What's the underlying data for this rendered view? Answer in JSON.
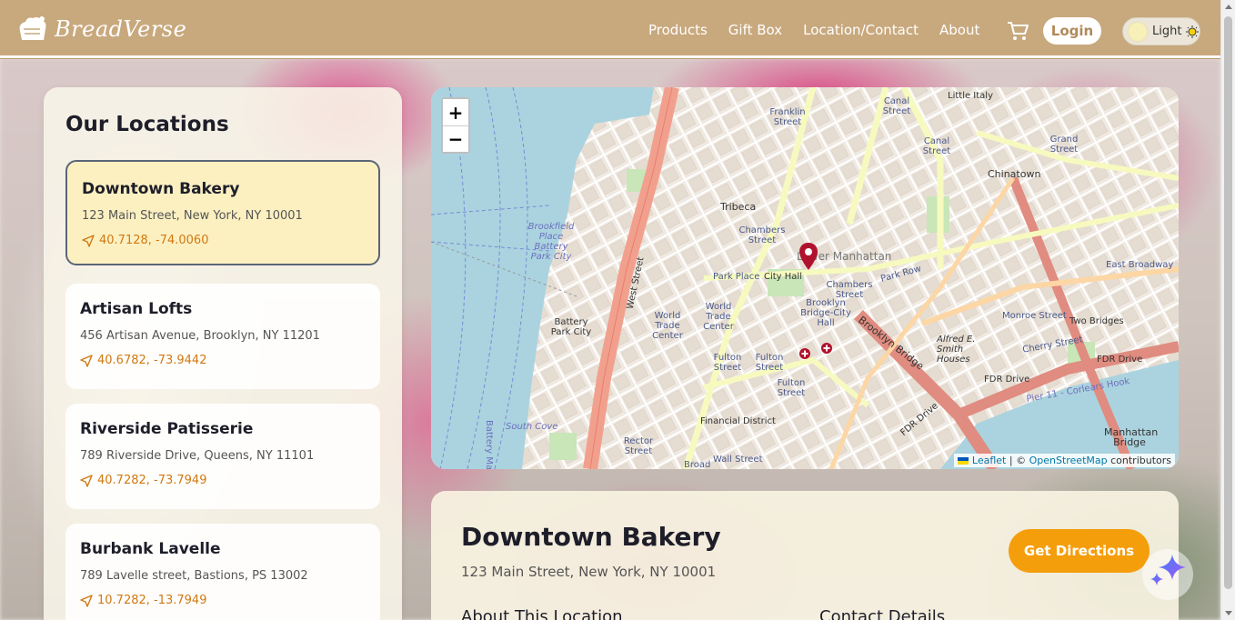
{
  "brand": {
    "name": "BreadVerse"
  },
  "nav": [
    "Products",
    "Gift Box",
    "Location/Contact",
    "About"
  ],
  "header": {
    "login_label": "Login",
    "theme_label": "Light"
  },
  "sidebar": {
    "title": "Our Locations",
    "locations": [
      {
        "name": "Downtown Bakery",
        "address": "123 Main Street, New York, NY 10001",
        "coords": "40.7128, -74.0060",
        "active": true
      },
      {
        "name": "Artisan Lofts",
        "address": "456 Artisan Avenue, Brooklyn, NY 11201",
        "coords": "40.6782, -73.9442"
      },
      {
        "name": "Riverside Patisserie",
        "address": "789 Riverside Drive, Queens, NY 11101",
        "coords": "40.7282, -73.7949"
      },
      {
        "name": "Burbank Lavelle",
        "address": "789 Lavelle street, Bastions, PS 13002",
        "coords": "10.7282, -13.7949"
      }
    ]
  },
  "map": {
    "zoom_in": "+",
    "zoom_out": "−",
    "attribution_leaflet": "Leaflet",
    "attribution_sep": " | © ",
    "attribution_osm": "OpenStreetMap",
    "attribution_tail": " contributors",
    "labels": {
      "franklin": "Franklin Street",
      "canal": "Canal Street",
      "canal2": "Canal Street",
      "little_italy": "Little Italy",
      "grand": "Grand Street",
      "chinatown": "Chinatown",
      "tribeca": "Tribeca",
      "chambers": "Chambers Street",
      "chambers2": "Chambers Street",
      "lower_manhattan": "Lower Manhattan",
      "park_place": "Park Place",
      "city_hall": "City Hall",
      "brooklyn_bridge_ch": "Brooklyn Bridge-City Hall",
      "brooklyn_bridge": "Brooklyn Bridge",
      "wtc": "World Trade Center",
      "wtc2": "World Trade Center",
      "battery_park_city": "Battery Park City",
      "brookfield": "Brookfield Place Battery Park City",
      "fulton": "Fulton Street",
      "fulton2": "Fulton Street",
      "fulton3": "Fulton Street",
      "financial": "Financial District",
      "rector": "Rector Street",
      "wall": "Wall Street",
      "broad": "Broad",
      "south_cove": "South Cove",
      "west_street": "West Street",
      "east_broadway": "East Broadway",
      "two_bridges": "Two Bridges",
      "alfred": "Alfred E. Smith Houses",
      "fdr": "FDR Drive",
      "fdr2": "FDR Drive",
      "fdr3": "FDR Drive",
      "pier": "Pier 11 - Corlears Hook",
      "manhattan_bridge": "Manhattan Bridge",
      "park_row": "Park Row",
      "monroe": "Monroe Street",
      "cherry": "Cherry Street",
      "battery_maritime": "Battery Ma"
    }
  },
  "details": {
    "name": "Downtown Bakery",
    "address": "123 Main Street, New York, NY 10001",
    "directions_label": "Get Directions",
    "about_heading": "About This Location",
    "contact_heading": "Contact Details"
  },
  "colors": {
    "header": "#c8a87d",
    "accent": "#f59e0b",
    "coords": "#d07912",
    "marker": "#b0122d"
  }
}
